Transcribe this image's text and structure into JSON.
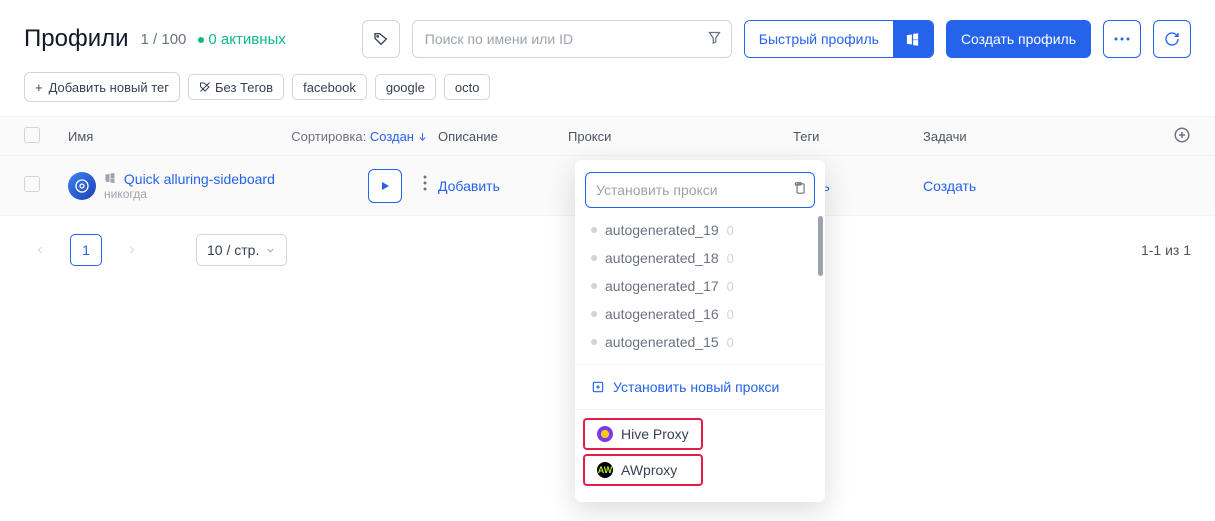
{
  "header": {
    "title": "Профили",
    "count": "1 / 100",
    "active": "0 активных",
    "search_placeholder": "Поиск по имени или ID",
    "quick_profile": "Быстрый профиль",
    "create_profile": "Создать профиль"
  },
  "tags": {
    "add_new": "Добавить новый тег",
    "no_tags": "Без Тегов",
    "items": [
      "facebook",
      "google",
      "octo"
    ]
  },
  "columns": {
    "name": "Имя",
    "sort_label": "Сортировка:",
    "sort_value": "Создан",
    "description": "Описание",
    "proxy": "Прокси",
    "tags": "Теги",
    "tasks": "Задачи"
  },
  "row": {
    "name": "Quick alluring-sideboard",
    "sub": "никогда",
    "add_desc": "Добавить",
    "add_tag_partial": "авить",
    "create_task": "Создать"
  },
  "pager": {
    "page": "1",
    "per_page": "10 / стр.",
    "summary": "1-1 из 1"
  },
  "dropdown": {
    "placeholder": "Установить прокси",
    "items": [
      {
        "name": "autogenerated_19",
        "count": "0"
      },
      {
        "name": "autogenerated_18",
        "count": "0"
      },
      {
        "name": "autogenerated_17",
        "count": "0"
      },
      {
        "name": "autogenerated_16",
        "count": "0"
      },
      {
        "name": "autogenerated_15",
        "count": "0"
      }
    ],
    "new_proxy": "Установить новый прокси",
    "providers": [
      {
        "name": "Hive Proxy"
      },
      {
        "name": "AWproxy"
      }
    ]
  }
}
